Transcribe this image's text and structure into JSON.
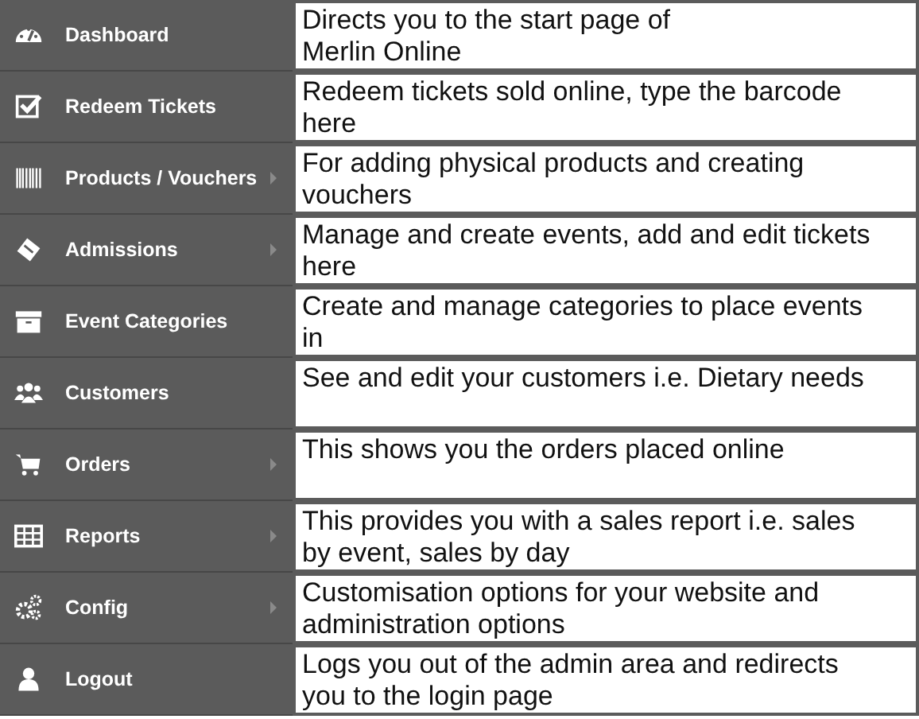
{
  "sidebar": {
    "items": [
      {
        "label": "Dashboard",
        "submenu": false,
        "description": [
          "Directs you to the start page of",
          "Merlin Online"
        ]
      },
      {
        "label": "Redeem Tickets",
        "submenu": false,
        "description": [
          "Redeem tickets sold online, type the barcode",
          "here"
        ]
      },
      {
        "label": "Products / Vouchers",
        "submenu": true,
        "description": [
          "For adding physical products and creating",
          "vouchers"
        ]
      },
      {
        "label": "Admissions",
        "submenu": true,
        "description": [
          "Manage and create events, add and edit tickets",
          "here"
        ]
      },
      {
        "label": "Event Categories",
        "submenu": false,
        "description": [
          "Create and manage categories to place events",
          "in"
        ]
      },
      {
        "label": "Customers",
        "submenu": false,
        "description": [
          "See and edit your customers i.e. Dietary needs"
        ]
      },
      {
        "label": "Orders",
        "submenu": true,
        "description": [
          "This shows you the orders placed online"
        ]
      },
      {
        "label": "Reports",
        "submenu": true,
        "description": [
          "This provides you with a sales report i.e. sales",
          "by event, sales by day"
        ]
      },
      {
        "label": "Config",
        "submenu": true,
        "description": [
          "Customisation options for your website and",
          "administration options"
        ]
      },
      {
        "label": "Logout",
        "submenu": false,
        "description": [
          "Logs you out of the admin area and redirects",
          "you to the login page"
        ]
      }
    ]
  }
}
